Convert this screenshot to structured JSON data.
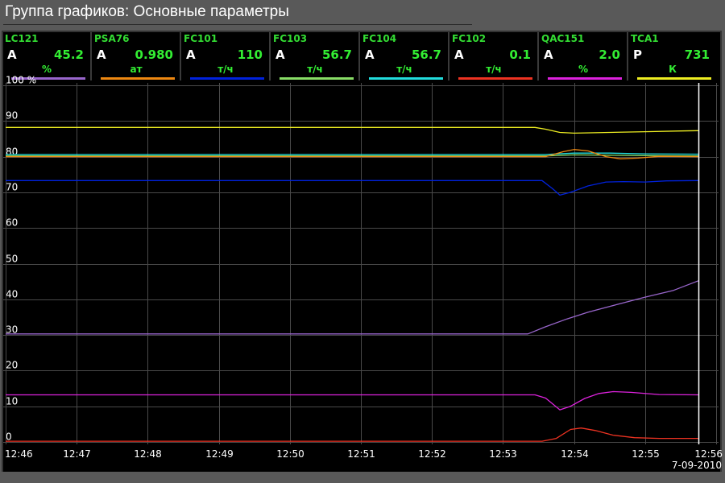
{
  "window": {
    "title": "Группа графиков: Основные параметры"
  },
  "tiles": [
    {
      "tag": "LC121",
      "mode": "A",
      "value": "45.2",
      "unit": "%",
      "color": "#9966cc"
    },
    {
      "tag": "PSA76",
      "mode": "A",
      "value": "0.980",
      "unit": "ат",
      "color": "#ee8811"
    },
    {
      "tag": "FC101",
      "mode": "A",
      "value": "110",
      "unit": "т/ч",
      "color": "#0022dd"
    },
    {
      "tag": "FC103",
      "mode": "A",
      "value": "56.7",
      "unit": "т/ч",
      "color": "#88dd66"
    },
    {
      "tag": "FC104",
      "mode": "A",
      "value": "56.7",
      "unit": "т/ч",
      "color": "#22dddd"
    },
    {
      "tag": "FC102",
      "mode": "A",
      "value": "0.1",
      "unit": "т/ч",
      "color": "#ee3322"
    },
    {
      "tag": "QAC151",
      "mode": "A",
      "value": "2.0",
      "unit": "%",
      "color": "#dd22dd"
    },
    {
      "tag": "TCA1",
      "mode": "P",
      "value": "731",
      "unit": "К",
      "color": "#eeee22"
    }
  ],
  "chart_data": {
    "type": "line",
    "title": "",
    "ylabel": "",
    "xlabel": "",
    "y_unit": "%",
    "ylim": [
      0,
      100
    ],
    "y_ticks": [
      "0",
      "10",
      "20",
      "30",
      "40",
      "50",
      "60",
      "70",
      "80",
      "90",
      "100 %"
    ],
    "x_ticks": [
      "12:46",
      "12:47",
      "12:48",
      "12:49",
      "12:50",
      "12:51",
      "12:52",
      "12:53",
      "12:54",
      "12:55",
      "12:56"
    ],
    "x_range_minutes": [
      0,
      10
    ],
    "date_label": "7-09-2010",
    "cursor_time_minutes": 9.75,
    "grid": true,
    "series": [
      {
        "name": "TCA1",
        "color": "#eeee22",
        "points": [
          [
            0,
            88.2
          ],
          [
            7.45,
            88.2
          ],
          [
            7.6,
            87.7
          ],
          [
            7.8,
            86.8
          ],
          [
            8.0,
            86.6
          ],
          [
            8.5,
            86.8
          ],
          [
            9.0,
            87.0
          ],
          [
            9.5,
            87.2
          ],
          [
            9.75,
            87.3
          ]
        ]
      },
      {
        "name": "FC104",
        "color": "#22dddd",
        "points": [
          [
            0,
            80.6
          ],
          [
            7.6,
            80.6
          ],
          [
            8.0,
            81.0
          ],
          [
            8.5,
            81.0
          ],
          [
            9.0,
            80.8
          ],
          [
            9.75,
            80.7
          ]
        ]
      },
      {
        "name": "FC103",
        "color": "#88dd66",
        "points": [
          [
            0,
            80.2
          ],
          [
            7.6,
            80.2
          ],
          [
            8.0,
            80.5
          ],
          [
            8.5,
            80.4
          ],
          [
            9.0,
            80.3
          ],
          [
            9.75,
            80.2
          ]
        ]
      },
      {
        "name": "PSA76",
        "color": "#ee8811",
        "points": [
          [
            0,
            80.0
          ],
          [
            7.6,
            80.0
          ],
          [
            7.85,
            81.4
          ],
          [
            8.0,
            82.0
          ],
          [
            8.2,
            81.6
          ],
          [
            8.45,
            80.0
          ],
          [
            8.65,
            79.4
          ],
          [
            8.9,
            79.6
          ],
          [
            9.2,
            80.1
          ],
          [
            9.75,
            80.0
          ]
        ]
      },
      {
        "name": "FC101",
        "color": "#0022dd",
        "points": [
          [
            0,
            73.3
          ],
          [
            7.55,
            73.3
          ],
          [
            7.7,
            71.0
          ],
          [
            7.8,
            69.2
          ],
          [
            7.95,
            70.0
          ],
          [
            8.2,
            71.8
          ],
          [
            8.45,
            72.9
          ],
          [
            8.7,
            73.0
          ],
          [
            9.0,
            72.9
          ],
          [
            9.3,
            73.2
          ],
          [
            9.75,
            73.3
          ]
        ]
      },
      {
        "name": "LC121",
        "color": "#9966cc",
        "points": [
          [
            0,
            30.3
          ],
          [
            7.35,
            30.3
          ],
          [
            7.6,
            32.3
          ],
          [
            7.9,
            34.5
          ],
          [
            8.2,
            36.4
          ],
          [
            8.6,
            38.5
          ],
          [
            9.0,
            40.6
          ],
          [
            9.4,
            42.5
          ],
          [
            9.75,
            45.2
          ]
        ]
      },
      {
        "name": "QAC151",
        "color": "#dd22dd",
        "points": [
          [
            0,
            13.2
          ],
          [
            7.45,
            13.2
          ],
          [
            7.6,
            12.3
          ],
          [
            7.8,
            9.0
          ],
          [
            7.95,
            10.0
          ],
          [
            8.15,
            12.2
          ],
          [
            8.35,
            13.6
          ],
          [
            8.55,
            14.1
          ],
          [
            8.8,
            13.9
          ],
          [
            9.2,
            13.3
          ],
          [
            9.75,
            13.2
          ]
        ]
      },
      {
        "name": "FC102",
        "color": "#ee3322",
        "points": [
          [
            0,
            0.2
          ],
          [
            7.55,
            0.2
          ],
          [
            7.75,
            1.0
          ],
          [
            7.95,
            3.5
          ],
          [
            8.1,
            3.9
          ],
          [
            8.3,
            3.2
          ],
          [
            8.55,
            1.9
          ],
          [
            8.85,
            1.2
          ],
          [
            9.2,
            1.0
          ],
          [
            9.75,
            1.0
          ]
        ]
      }
    ]
  }
}
